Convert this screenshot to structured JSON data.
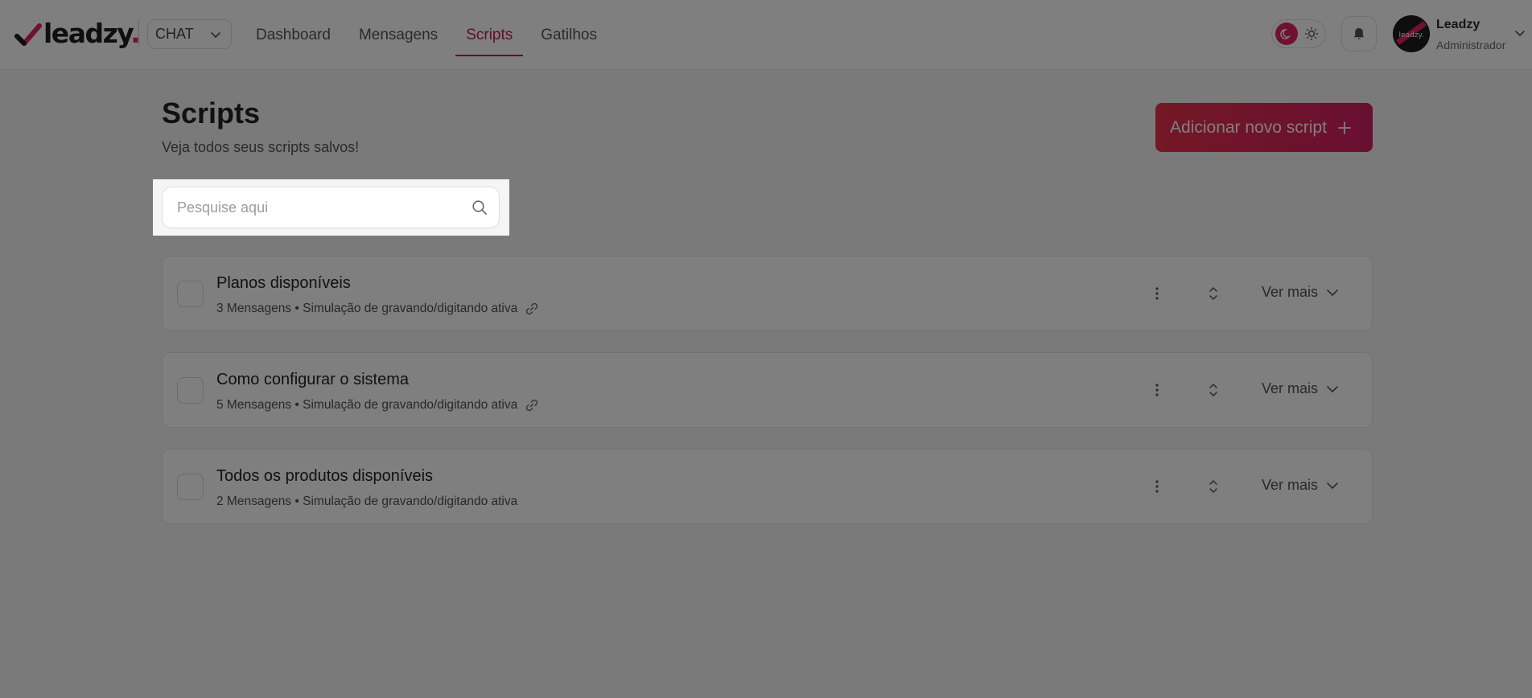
{
  "header": {
    "logo_text": "leadzy",
    "logo_dot": ".",
    "channel_select": "CHAT",
    "nav": [
      {
        "label": "Dashboard",
        "active": false
      },
      {
        "label": "Mensagens",
        "active": false
      },
      {
        "label": "Scripts",
        "active": true
      },
      {
        "label": "Gatilhos",
        "active": false
      }
    ],
    "user": {
      "name": "Leadzy",
      "role": "Administrador",
      "avatar_text": "leadzy."
    }
  },
  "page": {
    "title": "Scripts",
    "subtitle": "Veja todos seus scripts salvos!",
    "add_button": "Adicionar novo script"
  },
  "search": {
    "placeholder": "Pesquise aqui",
    "value": ""
  },
  "scripts": [
    {
      "title": "Planos disponíveis",
      "messages": "3 Mensagens",
      "separator": "•",
      "simulation": "Simulação de gravando/digitando ativa",
      "has_link": true,
      "more_label": "Ver mais"
    },
    {
      "title": "Como configurar o sistema",
      "messages": "5 Mensagens",
      "separator": "•",
      "simulation": "Simulação de gravando/digitando ativa",
      "has_link": true,
      "more_label": "Ver mais"
    },
    {
      "title": "Todos os produtos disponíveis",
      "messages": "2 Mensagens",
      "separator": "•",
      "simulation": "Simulação de gravando/digitando ativa",
      "has_link": false,
      "more_label": "Ver mais"
    }
  ],
  "colors": {
    "accent": "#c21855",
    "button_start": "#e8304d",
    "button_end": "#d21f63",
    "overlay": "rgba(0,0,0,0.5)"
  }
}
